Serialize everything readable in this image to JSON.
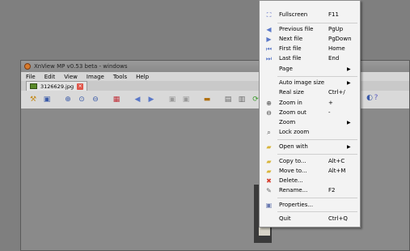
{
  "window": {
    "title": "XnView MP v0.53 beta - windows",
    "menubar": [
      "File",
      "Edit",
      "View",
      "Image",
      "Tools",
      "Help"
    ],
    "tab": {
      "label": "3126629.jpg",
      "close": "×"
    }
  },
  "toolbar_icons": [
    "browser-icon",
    "save-icon",
    "zoom-in-icon",
    "zoom-fit-icon",
    "zoom-out-icon",
    "grid-icon",
    "arrow-left-icon",
    "arrow-right-icon",
    "rotate-left-icon",
    "rotate-right-icon",
    "monitor-icon",
    "slideshow-icon",
    "print-icon",
    "refresh-green-icon",
    "refresh-yellow-icon",
    "crop-icon",
    "adjust-icon",
    "settings-icon",
    "help-icon"
  ],
  "menu": {
    "items": [
      {
        "label": "Fullscreen",
        "shortcut": "F11",
        "icon": "fullscreen-icon",
        "glyph": "⛶",
        "color": "#4a5cc0"
      },
      {
        "label": "Previous file",
        "shortcut": "PgUp",
        "icon": "previous-file-icon",
        "glyph": "◀",
        "color": "#5a78c8"
      },
      {
        "label": "Next file",
        "shortcut": "PgDown",
        "icon": "next-file-icon",
        "glyph": "▶",
        "color": "#5a78c8"
      },
      {
        "label": "First file",
        "shortcut": "Home",
        "icon": "first-file-icon",
        "glyph": "⏮",
        "color": "#5a78c8"
      },
      {
        "label": "Last file",
        "shortcut": "End",
        "icon": "last-file-icon",
        "glyph": "⏭",
        "color": "#5a78c8"
      },
      {
        "label": "Page",
        "shortcut": "",
        "icon": "",
        "glyph": "",
        "color": "#000",
        "submenu": "▶"
      },
      {
        "label": "Auto image size",
        "shortcut": "",
        "icon": "",
        "glyph": "",
        "color": "#000",
        "submenu": "▶"
      },
      {
        "label": "Real size",
        "shortcut": "Ctrl+/",
        "icon": "",
        "glyph": "",
        "color": "#000"
      },
      {
        "label": "Zoom in",
        "shortcut": "+",
        "icon": "zoom-in-icon",
        "glyph": "⊕",
        "color": "#444"
      },
      {
        "label": "Zoom out",
        "shortcut": "-",
        "icon": "zoom-out-icon",
        "glyph": "⊖",
        "color": "#444"
      },
      {
        "label": "Zoom",
        "shortcut": "",
        "icon": "",
        "glyph": "",
        "color": "#000",
        "submenu": "▶"
      },
      {
        "label": "Lock zoom",
        "shortcut": "",
        "icon": "lock-zoom-icon",
        "glyph": "🔍",
        "color": "#444"
      },
      {
        "label": "Open with",
        "shortcut": "",
        "icon": "open-with-icon",
        "glyph": "▰",
        "color": "#d8b43a",
        "submenu": "▶"
      },
      {
        "label": "Copy to...",
        "shortcut": "Alt+C",
        "icon": "copy-to-icon",
        "glyph": "▰",
        "color": "#d8b43a"
      },
      {
        "label": "Move to...",
        "shortcut": "Alt+M",
        "icon": "move-to-icon",
        "glyph": "▰",
        "color": "#d8b43a"
      },
      {
        "label": "Delete...",
        "shortcut": "",
        "icon": "delete-icon",
        "glyph": "✖",
        "color": "#d63c2c"
      },
      {
        "label": "Rename...",
        "shortcut": "F2",
        "icon": "rename-icon",
        "glyph": "✎",
        "color": "#6a6a6a"
      },
      {
        "label": "Properties...",
        "shortcut": "",
        "icon": "properties-icon",
        "glyph": "▣",
        "color": "#6a7ab0"
      },
      {
        "label": "Quit",
        "shortcut": "Ctrl+Q",
        "icon": "",
        "glyph": "",
        "color": "#000"
      }
    ]
  }
}
